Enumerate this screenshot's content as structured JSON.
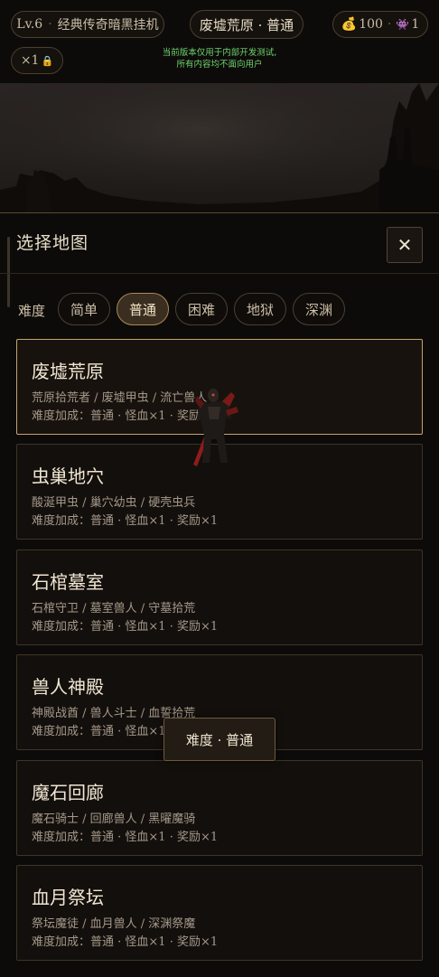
{
  "topbar": {
    "level": "Lv.6",
    "mode": "经典传奇暗黑挂机",
    "current_map": "废墟荒原 · 普通",
    "gold": "100",
    "enemies": "1",
    "multiplier": "×1",
    "notice_line1": "当前版本仅用于内部开发测试,",
    "notice_line2": "所有内容均不面向用户"
  },
  "panel": {
    "title": "选择地图",
    "close_label": "✕",
    "difficulty_label": "难度",
    "difficulties": [
      "简单",
      "普通",
      "困难",
      "地狱",
      "深渊"
    ],
    "selected_difficulty": "普通"
  },
  "maps": [
    {
      "name": "废墟荒原",
      "enemies": "荒原拾荒者 / 废墟甲虫 / 流亡兽人",
      "bonus": "难度加成：普通 · 怪血×1 · 奖励×1",
      "selected": true
    },
    {
      "name": "虫巢地穴",
      "enemies": "酸涎甲虫 / 巢穴幼虫 / 硬壳虫兵",
      "bonus": "难度加成：普通 · 怪血×1 · 奖励×1",
      "selected": false
    },
    {
      "name": "石棺墓室",
      "enemies": "石棺守卫 / 墓室兽人 / 守墓拾荒",
      "bonus": "难度加成：普通 · 怪血×1 · 奖励×1",
      "selected": false
    },
    {
      "name": "兽人神殿",
      "enemies": "神殿战酋 / 兽人斗士 / 血誓拾荒",
      "bonus": "难度加成：普通 · 怪血×1 · 奖励×1",
      "selected": false
    },
    {
      "name": "魔石回廊",
      "enemies": "魔石骑士 / 回廊兽人 / 黑曜魔骑",
      "bonus": "难度加成：普通 · 怪血×1 · 奖励×1",
      "selected": false
    },
    {
      "name": "血月祭坛",
      "enemies": "祭坛魔徒 / 血月兽人 / 深渊祭魔",
      "bonus": "难度加成：普通 · 怪血×1 · 奖励×1",
      "selected": false
    }
  ],
  "toast": "难度 · 普通",
  "colors": {
    "accent_gold": "#c4a46c",
    "notice_green": "#6fd46f",
    "panel_bg": "#0d0b09"
  }
}
